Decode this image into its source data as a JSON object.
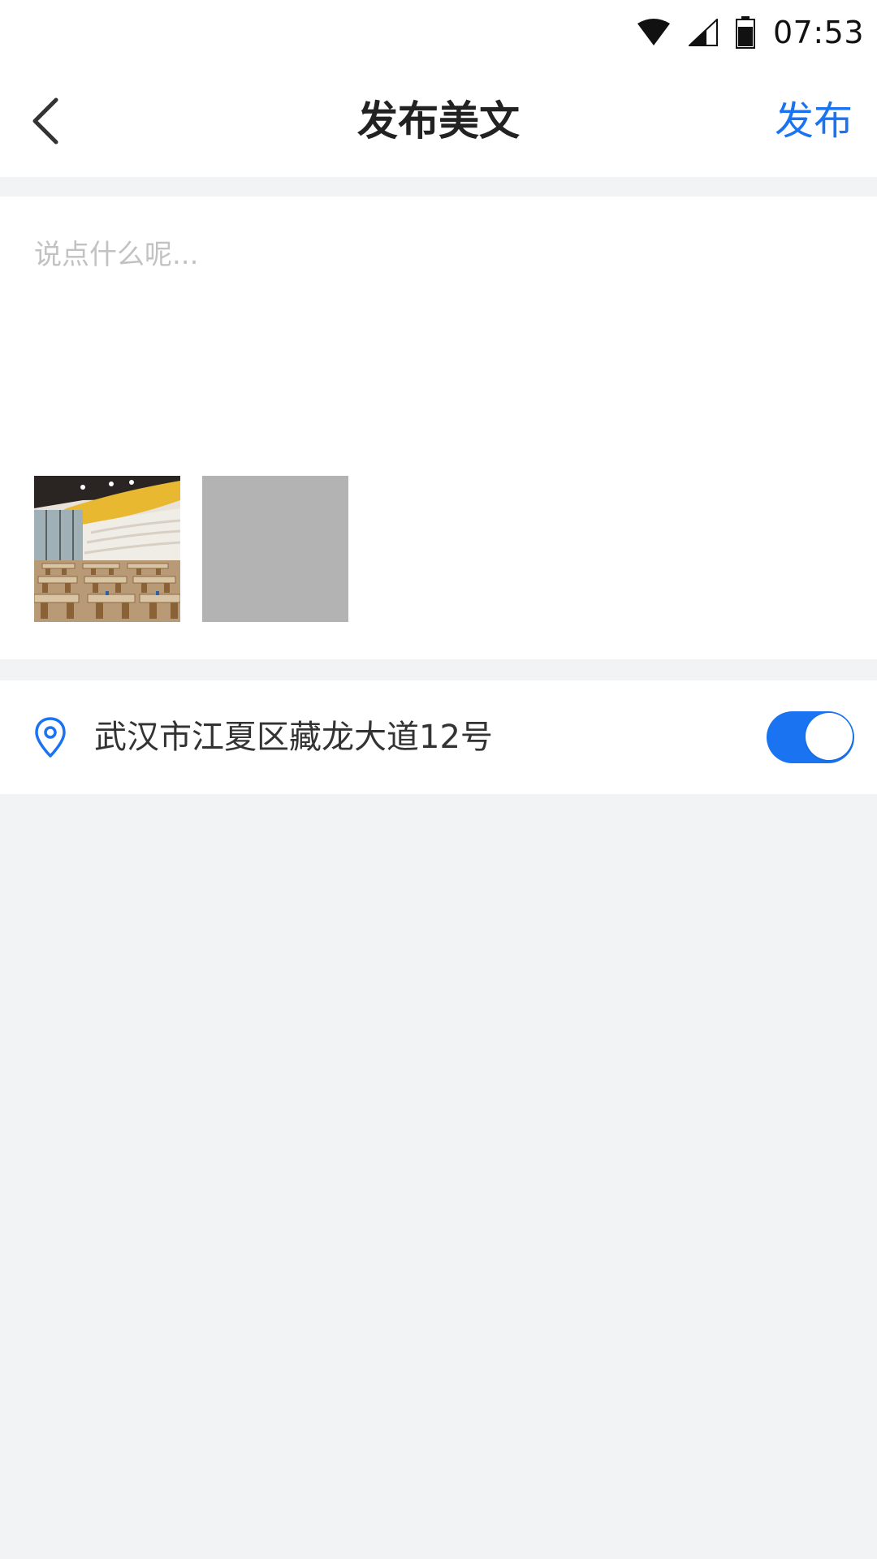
{
  "status_bar": {
    "time": "07:53",
    "icons": [
      "wifi-icon",
      "cellular-signal-icon",
      "battery-icon"
    ]
  },
  "nav": {
    "back_icon": "chevron-left-icon",
    "title": "发布美文",
    "publish_label": "发布"
  },
  "compose": {
    "placeholder": "说点什么呢...",
    "value": "",
    "photos": [
      {
        "type": "photo",
        "content": "restaurant dining room"
      },
      {
        "type": "placeholder",
        "content": "gray image placeholder"
      }
    ]
  },
  "location": {
    "icon": "location-pin-icon",
    "address": "武汉市江夏区藏龙大道12号",
    "enabled": true
  },
  "colors": {
    "accent": "#1a73f0",
    "background": "#f2f3f5",
    "card": "#ffffff",
    "placeholder_text": "#c2c2c2",
    "image_placeholder": "#b3b3b3"
  }
}
